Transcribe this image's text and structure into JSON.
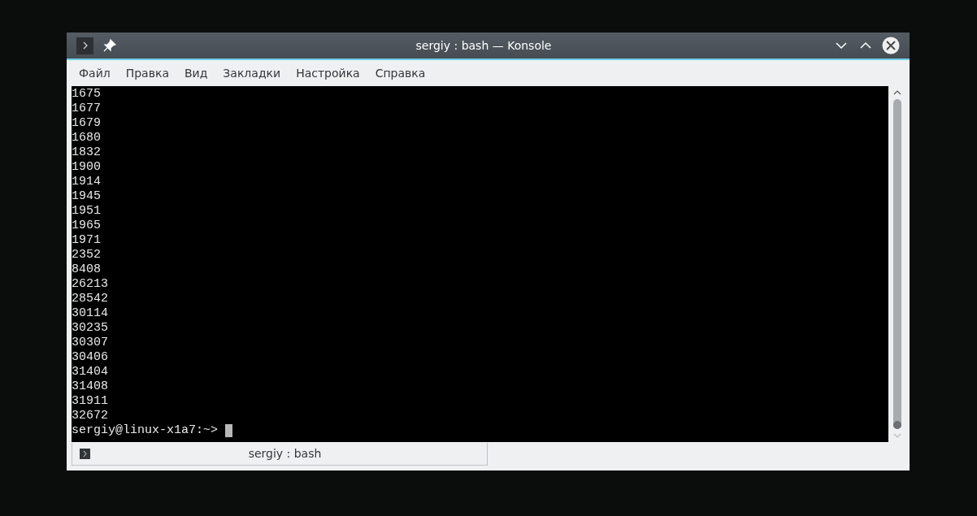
{
  "window": {
    "title": "sergiy : bash — Konsole"
  },
  "menu": [
    "Файл",
    "Правка",
    "Вид",
    "Закладки",
    "Настройка",
    "Справка"
  ],
  "terminal": {
    "lines": [
      "1675",
      "1677",
      "1679",
      "1680",
      "1832",
      "1900",
      "1914",
      "1945",
      "1951",
      "1965",
      "1971",
      "2352",
      "8408",
      "26213",
      "28542",
      "30114",
      "30235",
      "30307",
      "30406",
      "31404",
      "31408",
      "31911",
      "32672"
    ],
    "prompt": "sergiy@linux-x1a7:~>"
  },
  "tabs": [
    {
      "label": "sergiy : bash",
      "selected": true
    }
  ]
}
